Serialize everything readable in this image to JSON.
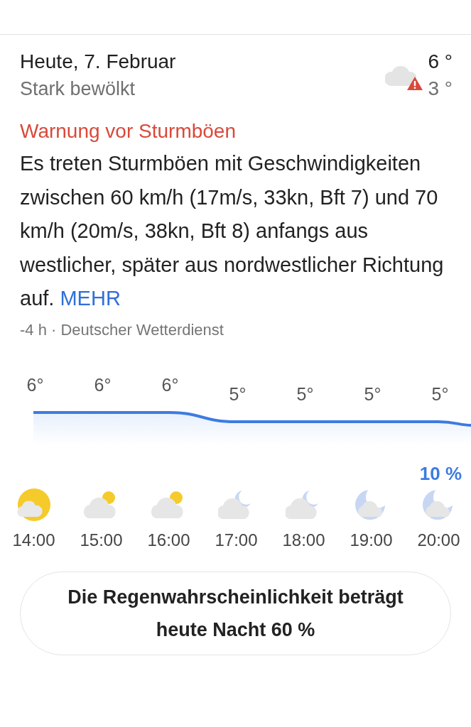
{
  "today": {
    "title": "Heute, 7. Februar",
    "condition": "Stark bewölkt",
    "high": "6 °",
    "low": "3 °",
    "warning": true
  },
  "warning": {
    "title": "Warnung vor Sturmböen",
    "text": "Es treten Sturmböen mit Geschwindigkeiten zwischen 60 km/h (17m/s, 33kn, Bft 7) und 70 km/h (20m/s, 38kn, Bft 8) anfangs aus westlicher, später aus nordwestlicher Richtung auf.",
    "more": "MEHR",
    "source": "-4 h · Deutscher Wetterdienst"
  },
  "hours": [
    {
      "temp": "6°",
      "time": "14:00",
      "kind": "sun"
    },
    {
      "temp": "6°",
      "time": "15:00",
      "kind": "cloudy-day"
    },
    {
      "temp": "6°",
      "time": "16:00",
      "kind": "cloudy-day"
    },
    {
      "temp": "5°",
      "time": "17:00",
      "kind": "cloudy-night"
    },
    {
      "temp": "5°",
      "time": "18:00",
      "kind": "cloudy-night"
    },
    {
      "temp": "5°",
      "time": "19:00",
      "kind": "night"
    },
    {
      "temp": "5°",
      "time": "20:00",
      "kind": "night",
      "precip": "10 %"
    }
  ],
  "rain_button": "Die Regenwahrscheinlichkeit beträgt heute Nacht 60 %"
}
